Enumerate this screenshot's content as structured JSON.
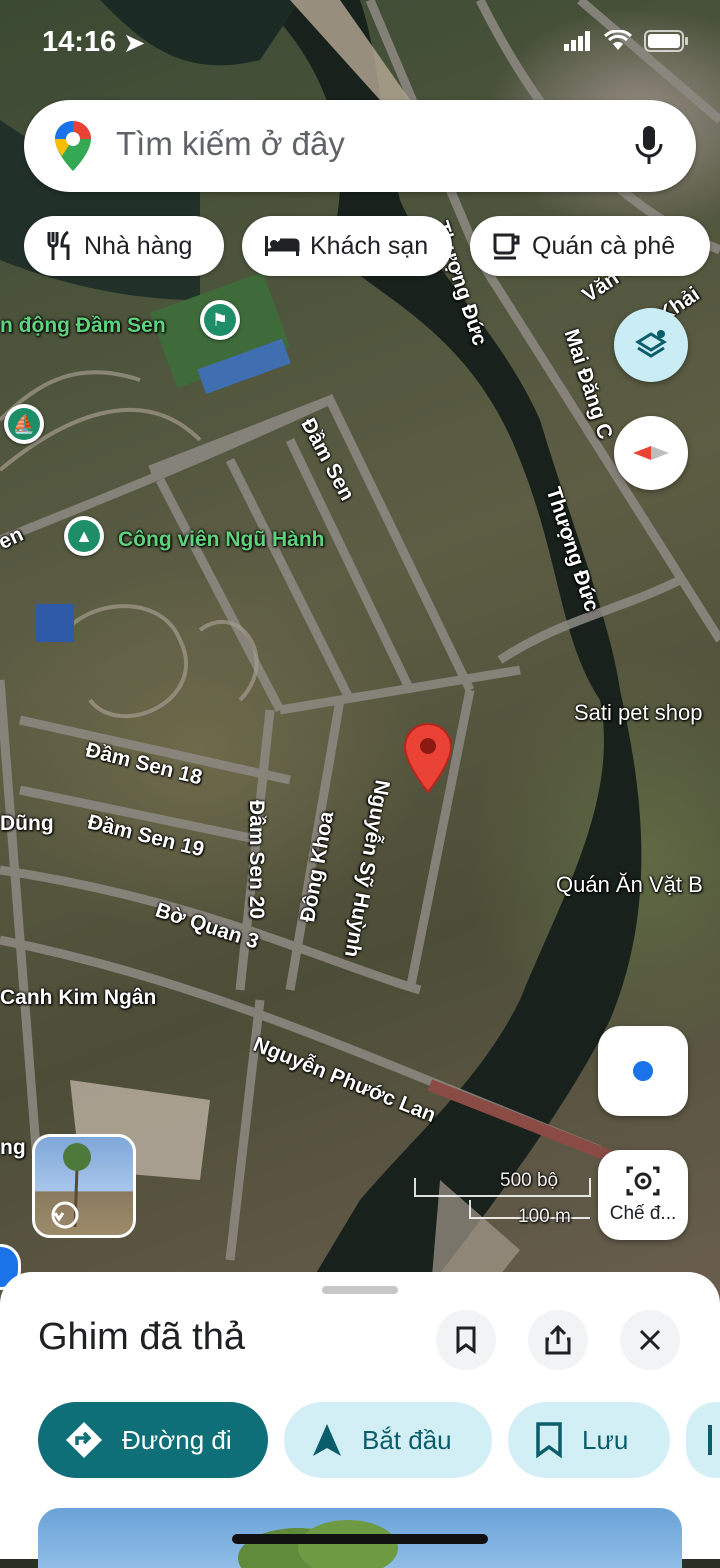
{
  "status_bar": {
    "time": "14:16"
  },
  "search": {
    "placeholder": "Tìm kiếm ở đây"
  },
  "chips": [
    {
      "label": "Nhà hàng",
      "icon": "restaurant-icon"
    },
    {
      "label": "Khách sạn",
      "icon": "hotel-icon"
    },
    {
      "label": "Quán cà phê",
      "icon": "coffee-icon"
    }
  ],
  "map_labels": {
    "dam_sen_park": "n động Đầm Sen",
    "dam_sen_road": "Đầm Sen",
    "cong_vien": "Công viên Ngũ Hành",
    "en": "en",
    "thuong_duc": "Thượng Đức",
    "thu_duc_top": "Thượng Đức",
    "mai_dang": "Mai Đăng C",
    "van_tan": "Văn Tân",
    "khai": "Khải",
    "sati": "Sati pet shop",
    "quan_an": "Quán Ăn Vặt B",
    "dam_sen_18": "Đầm Sen 18",
    "dam_sen_19": "Đầm Sen 19",
    "dam_sen_20": "Đầm Sen 20",
    "dung": "Dũng",
    "dong_khoa": "Đông Khoa",
    "nguyen_sy_huynh": "Nguyễn Sỹ Huỳnh",
    "bo_quan_3": "Bờ Quan 3",
    "canh_kim_ngan": "Canh Kim Ngân",
    "nguyen_phuoc_lan": "Nguyễn Phước Lan",
    "ng": "ng"
  },
  "scale": {
    "feet": "500 bộ",
    "meters": "100 m"
  },
  "lens_button": {
    "label": "Chế đ..."
  },
  "sheet": {
    "title": "Ghim đã thả",
    "actions": [
      {
        "label": "Đường đi"
      },
      {
        "label": "Bắt đầu"
      },
      {
        "label": "Lưu"
      }
    ]
  },
  "colors": {
    "primary": "#0e6f79",
    "secondary_bg": "#d3eff6",
    "pin": "#ea4335",
    "location_dot": "#1a73e8"
  }
}
